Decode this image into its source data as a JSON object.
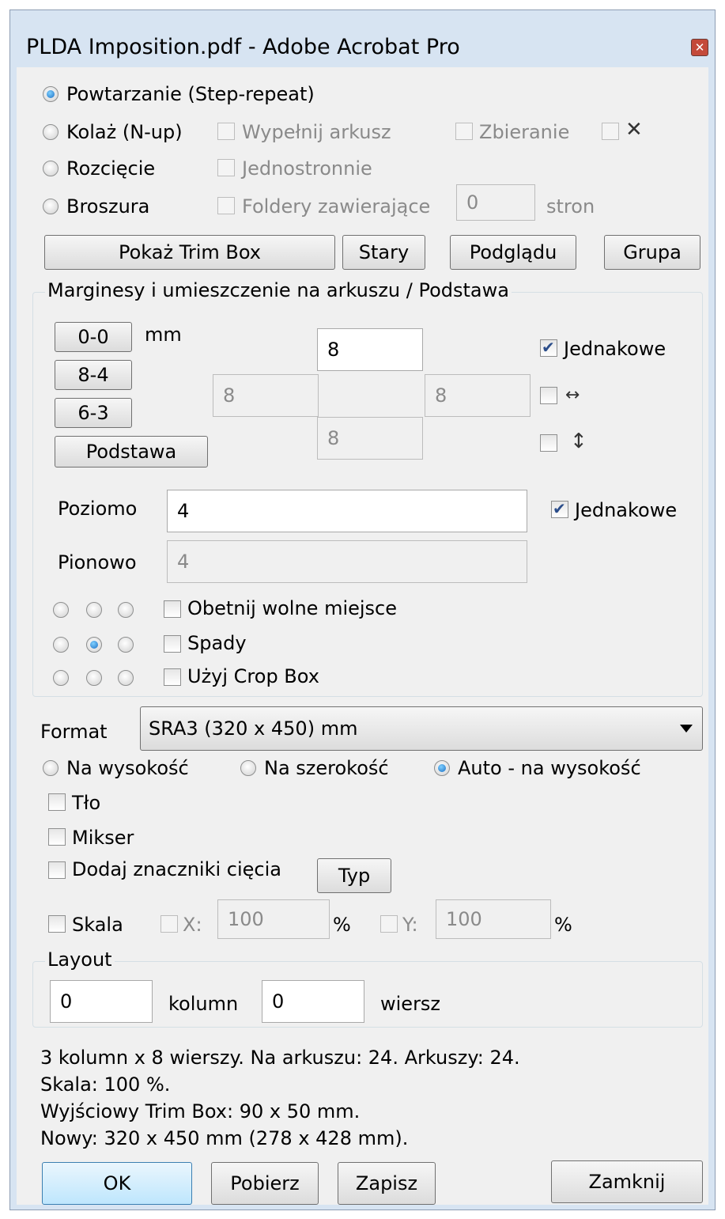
{
  "window": {
    "title": "PLDA Imposition.pdf - Adobe Acrobat Pro"
  },
  "modes": {
    "step_repeat": "Powtarzanie (Step-repeat)",
    "nup": "Kolaż (N-up)",
    "cut": "Rozcięcie",
    "booklet": "Broszura",
    "selected": "step_repeat"
  },
  "options": {
    "fill_sheet": "Wypełnij arkusz",
    "collect": "Zbieranie",
    "one_sided": "Jednostronnie",
    "folders": "Foldery zawierające",
    "folders_value": "0",
    "pages_unit": "stron"
  },
  "buttons": {
    "show_trim": "Pokaż Trim Box",
    "old": "Stary",
    "preview": "Podglądu",
    "group": "Grupa",
    "ok": "OK",
    "get": "Pobierz",
    "save": "Zapisz",
    "close": "Zamknij"
  },
  "margins": {
    "legend": "Marginesy i umieszczenie na arkuszu / Podstawa",
    "preset1": "0-0",
    "preset2": "8-4",
    "preset3": "6-3",
    "base": "Podstawa",
    "unit": "mm",
    "top": "8",
    "left": "8",
    "right": "8",
    "bottom": "8",
    "equal": "Jednakowe",
    "equal_checked": true,
    "horizontal_label": "Poziomo",
    "horizontal_value": "4",
    "vertical_label": "Pionowo",
    "vertical_value": "4",
    "spacing_equal": "Jednakowe",
    "spacing_equal_checked": true,
    "trim_free": "Obetnij wolne miejsce",
    "bleed": "Spady",
    "use_crop": "Użyj Crop Box",
    "anchor_selected": "center"
  },
  "format": {
    "label": "Format",
    "value": "SRA3 (320 x 450) mm",
    "portrait": "Na wysokość",
    "landscape": "Na szerokość",
    "auto": "Auto - na wysokość",
    "orientation_selected": "auto",
    "background": "Tło",
    "mixer": "Mikser",
    "crop_marks": "Dodaj znaczniki cięcia",
    "type_btn": "Typ",
    "scale": "Skala",
    "x_label": "X:",
    "x_value": "100",
    "y_label": "Y:",
    "y_value": "100",
    "percent": "%"
  },
  "layout": {
    "legend": "Layout",
    "columns_value": "0",
    "columns_label": "kolumn",
    "rows_value": "0",
    "rows_label": "wiersz"
  },
  "summary": {
    "line1": "3 kolumn x 8 wierszy. Na arkuszu: 24. Arkuszy: 24.",
    "line2": "Skala: 100 %.",
    "line3": "Wyjściowy Trim Box: 90 x 50 mm.",
    "line4": "Nowy: 320 x 450 mm (278 x 428 mm)."
  }
}
